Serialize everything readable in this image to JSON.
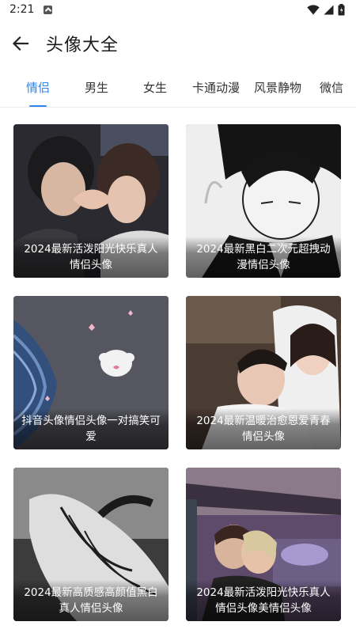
{
  "status_bar": {
    "time": "2:21"
  },
  "header": {
    "title": "头像大全"
  },
  "tabs": [
    {
      "label": "情侣",
      "active": true
    },
    {
      "label": "男生",
      "active": false
    },
    {
      "label": "女生",
      "active": false
    },
    {
      "label": "卡通动漫",
      "active": false
    },
    {
      "label": "风景静物",
      "active": false
    },
    {
      "label": "微信",
      "active": false
    }
  ],
  "cards": [
    {
      "caption": "2024最新活泼阳光快乐真人情侣头像"
    },
    {
      "caption": "2024最新黑白二次元超拽动漫情侣头像"
    },
    {
      "caption": "抖音头像情侣头像一对搞笑可爱"
    },
    {
      "caption": "2024最新温暖治愈恩爱青春情侣头像"
    },
    {
      "caption": "2024最新高质感高颜值黑白真人情侣头像"
    },
    {
      "caption": "2024最新活泼阳光快乐真人情侣头像美情侣头像"
    }
  ],
  "colors": {
    "accent": "#2f86e8"
  }
}
